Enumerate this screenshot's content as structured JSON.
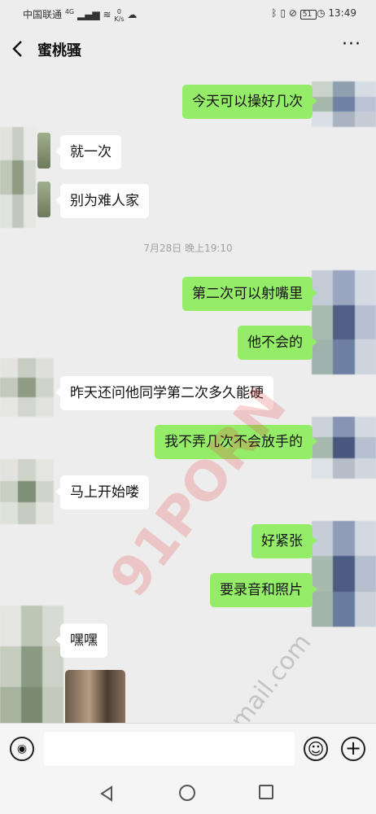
{
  "status_bar": {
    "carrier": "中国联通",
    "network": "4G",
    "speed_value": "0",
    "speed_unit": "K/s",
    "battery": "51",
    "time": "13:49"
  },
  "header": {
    "title": "蜜桃骚"
  },
  "messages": [
    {
      "side": "out",
      "text": "今天可以操好几次"
    },
    {
      "side": "in",
      "text": "就一次"
    },
    {
      "side": "in",
      "text": "别为难人家"
    },
    {
      "side": "out",
      "text": "第二次可以射嘴里"
    },
    {
      "side": "out",
      "text": "他不会的"
    },
    {
      "side": "in",
      "text": "昨天还问他同学第二次多久能硬"
    },
    {
      "side": "out",
      "text": "我不弄几次不会放手的"
    },
    {
      "side": "in",
      "text": "马上开始喽"
    },
    {
      "side": "out",
      "text": "好紧张"
    },
    {
      "side": "out",
      "text": "要录音和照片"
    },
    {
      "side": "in",
      "text": "嘿嘿"
    }
  ],
  "timestamp": "7月28日 晚上19:10",
  "watermark": {
    "main": "91PORN",
    "sub": "izhi@gmail.com"
  },
  "icons": {
    "back": "chevron-left-icon",
    "more": "more-dots-icon",
    "voice": "voice-icon",
    "emoji": "emoji-icon",
    "plus": "plus-icon"
  },
  "colors": {
    "outgoing_bubble": "#95ec69",
    "incoming_bubble": "#ffffff",
    "background": "#ededed"
  }
}
